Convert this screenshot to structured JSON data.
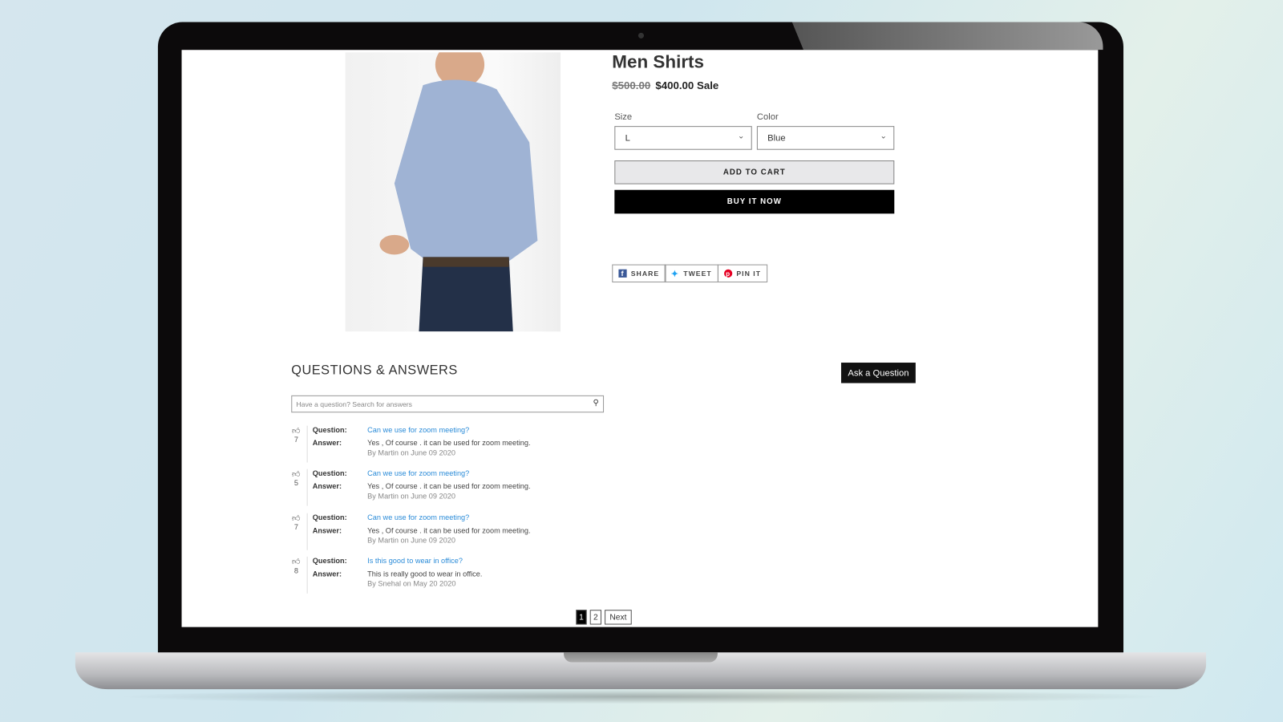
{
  "product": {
    "title": "Men Shirts",
    "original_price": "$500.00",
    "sale_price": "$400.00",
    "sale_label": "Sale",
    "size_label": "Size",
    "size_value": "L",
    "color_label": "Color",
    "color_value": "Blue",
    "add_to_cart": "ADD TO CART",
    "buy_now": "BUY IT NOW"
  },
  "social": {
    "share": "SHARE",
    "tweet": "TWEET",
    "pin": "PIN IT"
  },
  "qa": {
    "heading": "QUESTIONS & ANSWERS",
    "ask_button": "Ask a Question",
    "search_placeholder": "Have a question? Search for answers",
    "question_label": "Question:",
    "answer_label": "Answer:",
    "items": [
      {
        "votes": "7",
        "question": "Can we use for zoom meeting?",
        "answer": "Yes , Of course . it can be used for zoom meeting.",
        "byline": "By Martin on June 09 2020"
      },
      {
        "votes": "5",
        "question": "Can we use for zoom meeting?",
        "answer": "Yes , Of course . it can be used for zoom meeting.",
        "byline": "By Martin on June 09 2020"
      },
      {
        "votes": "7",
        "question": "Can we use for zoom meeting?",
        "answer": "Yes , Of course . it can be used for zoom meeting.",
        "byline": "By Martin on June 09 2020"
      },
      {
        "votes": "8",
        "question": "Is this good to wear in office?",
        "answer": "This is really good to wear in office.",
        "byline": "By Snehal on May 20 2020"
      }
    ]
  },
  "pagination": {
    "pages": [
      "1",
      "2"
    ],
    "current": "1",
    "next": "Next"
  },
  "colors": {
    "link": "#2a8bd8",
    "facebook": "#3b5998",
    "twitter": "#1da1f2",
    "pinterest": "#e60023"
  }
}
